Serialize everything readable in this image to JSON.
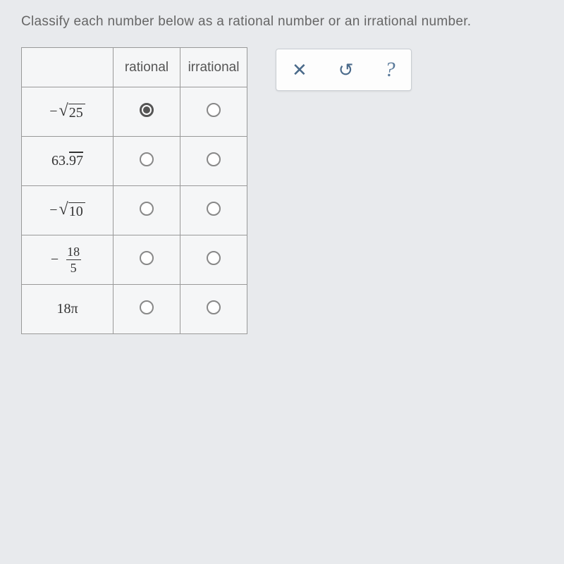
{
  "question": "Classify each number below as a rational number or an irrational number.",
  "headers": {
    "blank": "",
    "rational": "rational",
    "irrational": "irrational"
  },
  "rows": [
    {
      "type": "sqrt",
      "neg": "−",
      "radicand": "25",
      "selected": "rational"
    },
    {
      "type": "repeating",
      "intpart": "63.",
      "reppart": "97",
      "selected": ""
    },
    {
      "type": "sqrt",
      "neg": "−",
      "radicand": "10",
      "selected": ""
    },
    {
      "type": "fraction",
      "neg": "−",
      "num": "18",
      "den": "5",
      "selected": ""
    },
    {
      "type": "plain",
      "text": "18π",
      "selected": ""
    }
  ],
  "toolbar": {
    "close": "✕",
    "reset": "↺",
    "help": "?"
  }
}
